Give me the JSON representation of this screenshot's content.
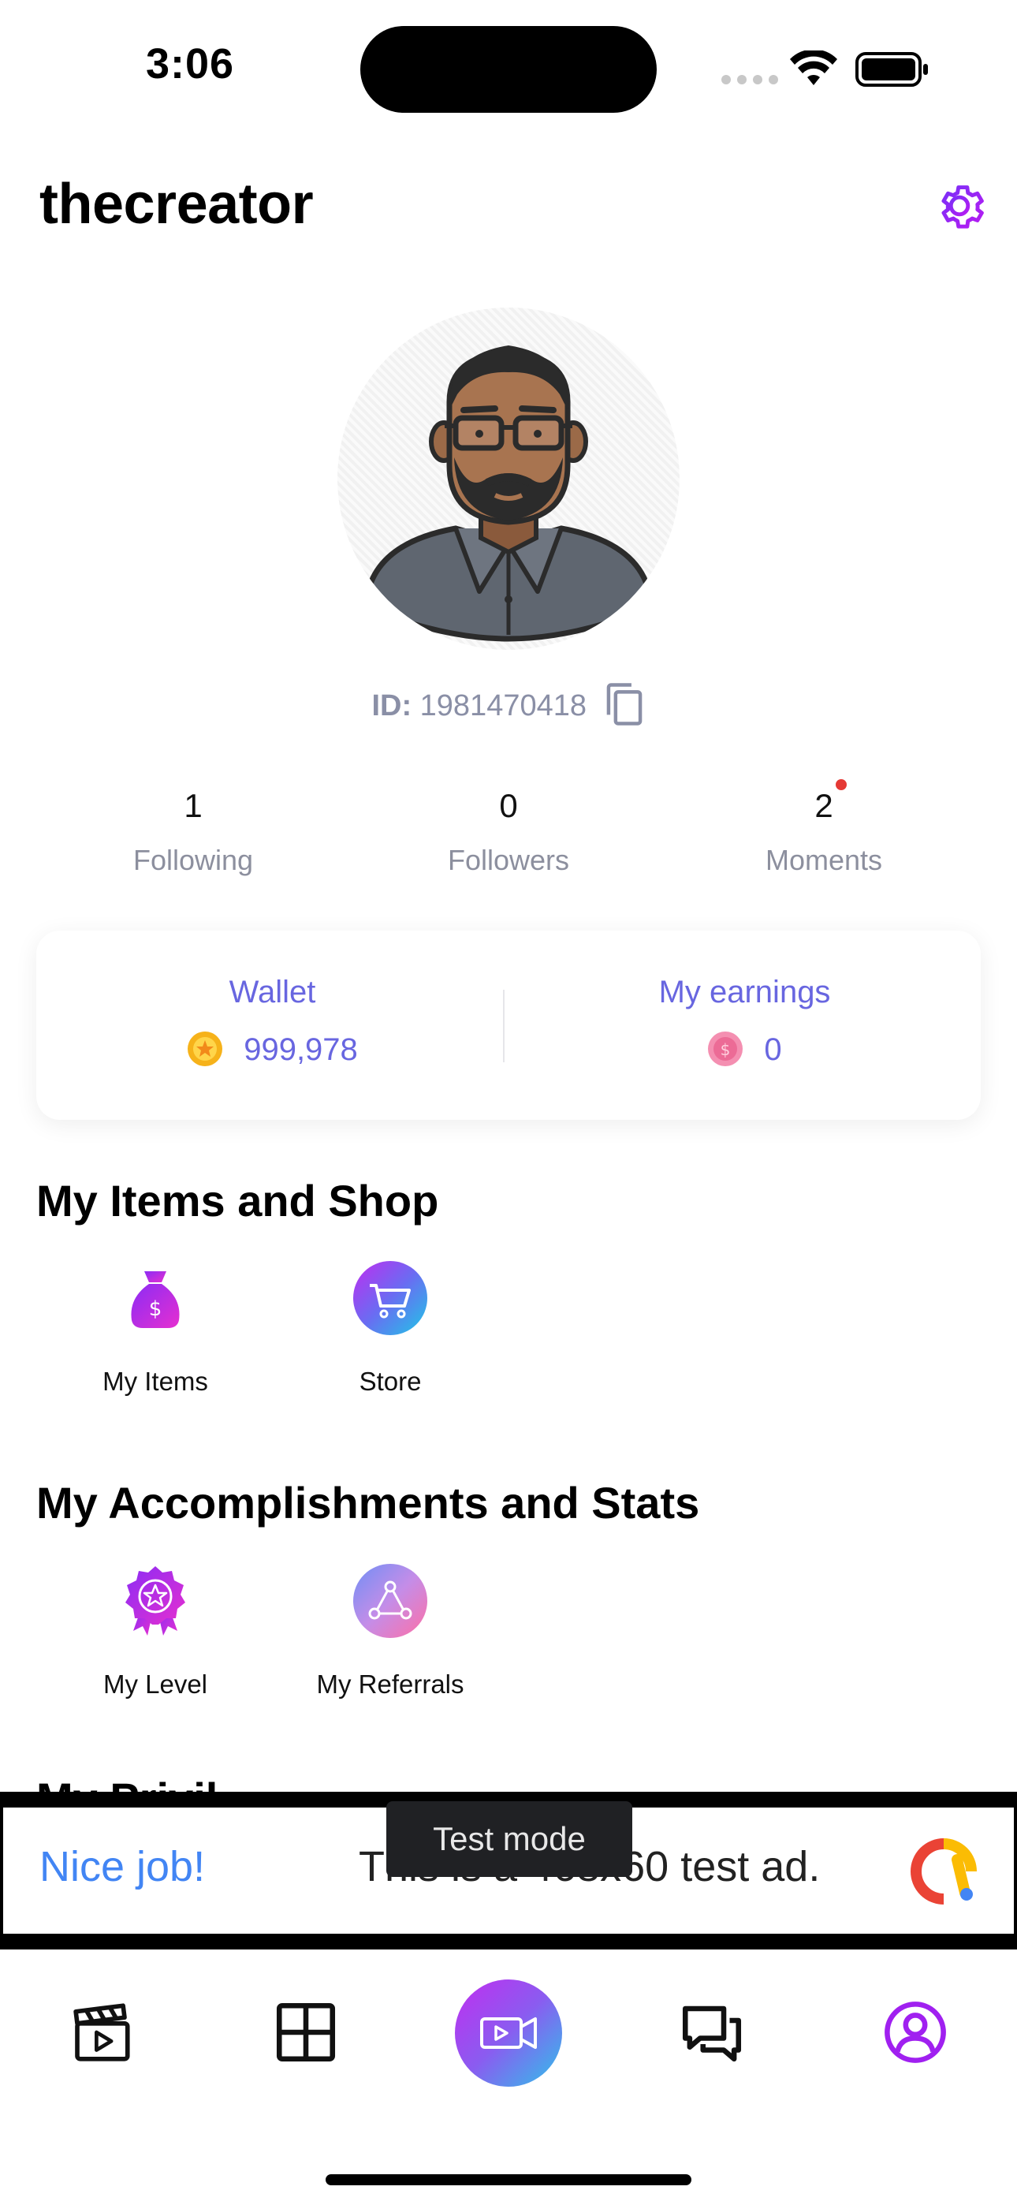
{
  "status_bar": {
    "time": "3:06"
  },
  "header": {
    "username": "thecreator",
    "settings_icon": "gear-icon"
  },
  "profile": {
    "id_label": "ID:",
    "id_value": "1981470418"
  },
  "stats": [
    {
      "value": "1",
      "label": "Following"
    },
    {
      "value": "0",
      "label": "Followers"
    },
    {
      "value": "2",
      "label": "Moments",
      "has_notification_dot": true
    }
  ],
  "wallet": {
    "wallet_title": "Wallet",
    "wallet_value": "999,978",
    "earnings_title": "My earnings",
    "earnings_value": "0"
  },
  "sections": {
    "items_shop": {
      "title": "My Items and Shop",
      "tiles": [
        {
          "label": "My Items"
        },
        {
          "label": "Store"
        }
      ]
    },
    "accomplishments": {
      "title": "My Accomplishments and Stats",
      "tiles": [
        {
          "label": "My Level"
        },
        {
          "label": "My Referrals"
        }
      ]
    }
  },
  "ad": {
    "headline": "Nice job!",
    "body": "This is a 468x60 test ad.",
    "test_mode_label": "Test mode"
  },
  "bottom_nav": {
    "items": [
      "clapperboard-icon",
      "grid-icon",
      "record-video-icon",
      "chat-icon",
      "profile-icon"
    ],
    "active": "profile-icon"
  },
  "colors": {
    "accent": "#6866e0",
    "purple": "#9c1ff0",
    "nav_active": "#a020f0",
    "ad_blue": "#4285f4"
  }
}
